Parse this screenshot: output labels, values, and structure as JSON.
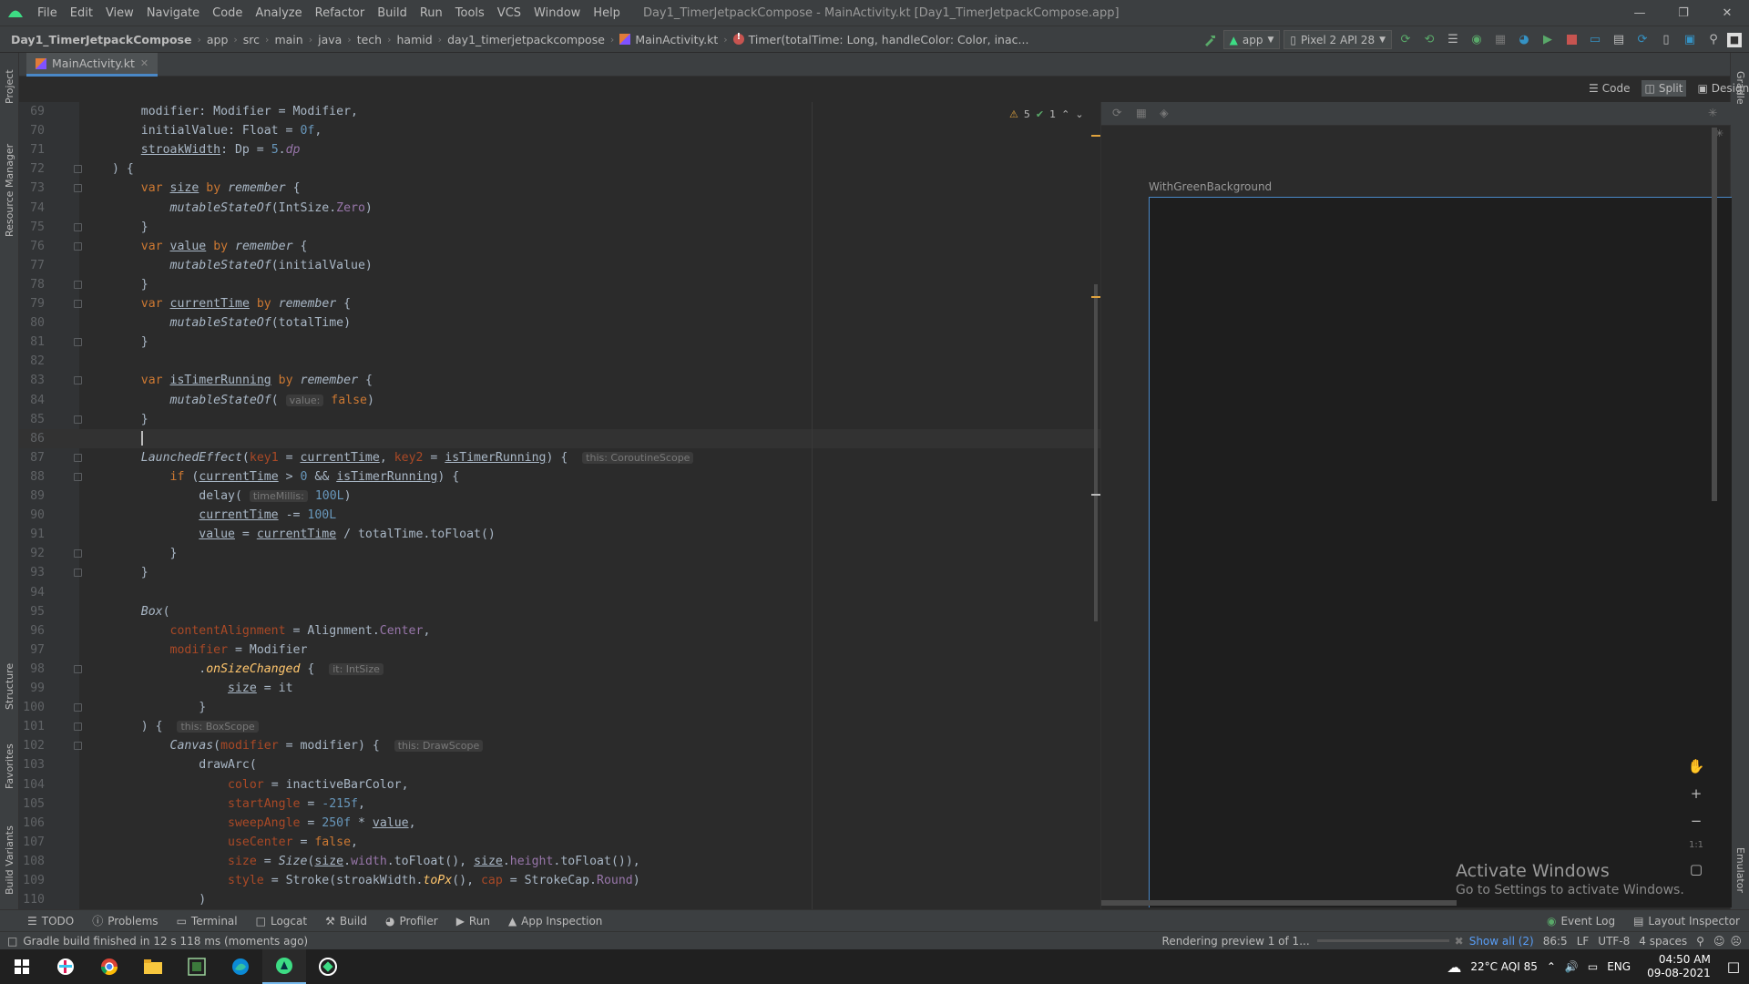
{
  "menubar": {
    "items": [
      "File",
      "Edit",
      "View",
      "Navigate",
      "Code",
      "Analyze",
      "Refactor",
      "Build",
      "Run",
      "Tools",
      "VCS",
      "Window",
      "Help"
    ],
    "title": "Day1_TimerJetpackCompose - MainActivity.kt [Day1_TimerJetpackCompose.app]"
  },
  "breadcrumbs": [
    "Day1_TimerJetpackCompose",
    "app",
    "src",
    "main",
    "java",
    "tech",
    "hamid",
    "day1_timerjetpackcompose",
    "MainActivity.kt",
    "Timer(totalTime: Long, handleColor: Color, inac..."
  ],
  "toolbar": {
    "run_config": "app",
    "device": "Pixel 2 API 28"
  },
  "tabs": [
    {
      "label": "MainActivity.kt"
    }
  ],
  "view_modes": [
    "Code",
    "Split",
    "Design"
  ],
  "inspection": {
    "warnings": "5",
    "ok": "1"
  },
  "editor": {
    "lines": [
      {
        "n": "69",
        "html": "    modifier: Modifier = Modifier,"
      },
      {
        "n": "70",
        "html": "    initialValue: Float = <span class='num'>0f</span>,"
      },
      {
        "n": "71",
        "html": "    <span class='ul'>stroakWidth</span>: Dp = <span class='num'>5</span>.<span class='prop it'>dp</span>"
      },
      {
        "n": "72",
        "html": ") {",
        "fold": true
      },
      {
        "n": "73",
        "html": "    <span class='kw'>var</span> <span class='ul'>size</span> <span class='kw'>by</span> <span class='it'>remember</span> {",
        "fold": true
      },
      {
        "n": "74",
        "html": "        <span class='it'>mutableStateOf</span>(IntSize.<span class='prop'>Zero</span>)"
      },
      {
        "n": "75",
        "html": "    }",
        "fold": true
      },
      {
        "n": "76",
        "html": "    <span class='kw'>var</span> <span class='ul'>value</span> <span class='kw'>by</span> <span class='it'>remember</span> {",
        "fold": true
      },
      {
        "n": "77",
        "html": "        <span class='it'>mutableStateOf</span>(initialValue)"
      },
      {
        "n": "78",
        "html": "    }",
        "fold": true
      },
      {
        "n": "79",
        "html": "    <span class='kw'>var</span> <span class='ul'>currentTime</span> <span class='kw'>by</span> <span class='it'>remember</span> {",
        "fold": true
      },
      {
        "n": "80",
        "html": "        <span class='it'>mutableStateOf</span>(totalTime)"
      },
      {
        "n": "81",
        "html": "    }",
        "fold": true
      },
      {
        "n": "82",
        "html": ""
      },
      {
        "n": "83",
        "html": "    <span class='kw'>var</span> <span class='ul'>isTimerRunning</span> <span class='kw'>by</span> <span class='it'>remember</span> {",
        "fold": true
      },
      {
        "n": "84",
        "html": "        <span class='it'>mutableStateOf</span>( <span class='hint'>value:</span> <span class='kw'>false</span>)"
      },
      {
        "n": "85",
        "html": "    }",
        "fold": true
      },
      {
        "n": "86",
        "html": "    ",
        "current": true
      },
      {
        "n": "87",
        "html": "    <span class='it'>LaunchedEffect</span>(<span class='param'>key1</span> = <span class='ul'>currentTime</span>, <span class='param'>key2</span> = <span class='ul'>isTimerRunning</span>) {  <span class='hint'>this: CoroutineScope</span>",
        "fold": true
      },
      {
        "n": "88",
        "html": "        <span class='kw'>if</span> (<span class='ul'>currentTime</span> > <span class='num'>0</span> && <span class='ul'>isTimerRunning</span>) {",
        "fold": true
      },
      {
        "n": "89",
        "html": "            delay( <span class='hint'>timeMillis:</span> <span class='num'>100L</span>)"
      },
      {
        "n": "90",
        "html": "            <span class='ul'>currentTime</span> -= <span class='num'>100L</span>"
      },
      {
        "n": "91",
        "html": "            <span class='ul'>value</span> = <span class='ul'>currentTime</span> / totalTime.toFloat()"
      },
      {
        "n": "92",
        "html": "        }",
        "fold": true
      },
      {
        "n": "93",
        "html": "    }",
        "fold": true
      },
      {
        "n": "94",
        "html": ""
      },
      {
        "n": "95",
        "html": "    <span class='it'>Box</span>("
      },
      {
        "n": "96",
        "html": "        <span class='param'>contentAlignment</span> = Alignment.<span class='prop'>Center</span>,"
      },
      {
        "n": "97",
        "html": "        <span class='param'>modifier</span> = Modifier"
      },
      {
        "n": "98",
        "html": "            .<span class='fn it'>onSizeChanged</span> {  <span class='hint'>it: IntSize</span>",
        "fold": true
      },
      {
        "n": "99",
        "html": "                <span class='ul'>size</span> = it"
      },
      {
        "n": "100",
        "html": "            }",
        "fold": true
      },
      {
        "n": "101",
        "html": "    ) {  <span class='hint'>this: BoxScope</span>",
        "fold": true
      },
      {
        "n": "102",
        "html": "        <span class='it'>Canvas</span>(<span class='param'>modifier</span> = modifier) {  <span class='hint'>this: DrawScope</span>",
        "fold": true
      },
      {
        "n": "103",
        "html": "            drawArc("
      },
      {
        "n": "104",
        "html": "                <span class='param'>color</span> = inactiveBarColor,"
      },
      {
        "n": "105",
        "html": "                <span class='param'>startAngle</span> = <span class='num'>-215f</span>,"
      },
      {
        "n": "106",
        "html": "                <span class='param'>sweepAngle</span> = <span class='num'>250f</span> * <span class='ul'>value</span>,"
      },
      {
        "n": "107",
        "html": "                <span class='param'>useCenter</span> = <span class='kw'>false</span>,"
      },
      {
        "n": "108",
        "html": "                <span class='param'>size</span> = <span class='it'>Size</span>(<span class='ul'>size</span>.<span class='prop'>width</span>.toFloat(), <span class='ul'>size</span>.<span class='prop'>height</span>.toFloat()),"
      },
      {
        "n": "109",
        "html": "                <span class='param'>style</span> = Stroke(stroakWidth.<span class='fn it'>toPx</span>(), <span class='param'>cap</span> = StrokeCap.<span class='prop'>Round</span>)"
      },
      {
        "n": "110",
        "html": "            )"
      }
    ]
  },
  "preview": {
    "label": "WithGreenBackground"
  },
  "activate": {
    "title": "Activate Windows",
    "subtitle": "Go to Settings to activate Windows."
  },
  "bottom_tools": [
    "TODO",
    "Problems",
    "Terminal",
    "Logcat",
    "Build",
    "Profiler",
    "Run",
    "App Inspection"
  ],
  "bottom_right_tools": [
    "Event Log",
    "Layout Inspector"
  ],
  "status": {
    "message": "Gradle build finished in 12 s 118 ms (moments ago)",
    "rendering": "Rendering preview 1 of 1...",
    "show_all": "Show all (2)",
    "position": "86:5",
    "line_sep": "LF",
    "encoding": "UTF-8",
    "indent": "4 spaces"
  },
  "taskbar": {
    "weather": "22°C AQI 85",
    "lang": "ENG",
    "time": "04:50 AM",
    "date": "09-08-2021"
  },
  "left_tool_tabs": [
    "Project",
    "Resource Manager",
    "Structure",
    "Favorites",
    "Build Variants"
  ],
  "right_tool_tabs": [
    "Gradle",
    "Emulator"
  ]
}
